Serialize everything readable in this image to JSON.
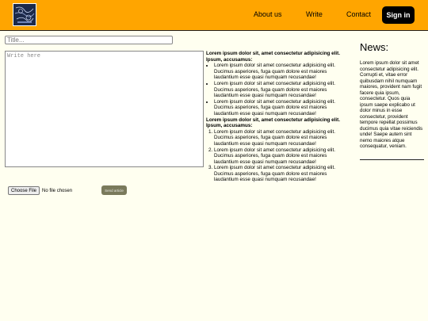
{
  "header": {
    "nav": [
      "About us",
      "Write",
      "Contact"
    ],
    "signin_label": "Sign in"
  },
  "editor": {
    "title_placeholder": "Title...",
    "body_placeholder": "Write here"
  },
  "preview": {
    "heading_1": "Lorem ipsum dolor sit, amet consectetur adipisicing elit. Ipsum, accusamus:",
    "bullets": [
      "Lorem ipsum dolor sit amet consectetur adipisicing elit. Ducimus asperiores, fuga quam dolore est maiores laudantium esse quasi numquam recusandae!",
      "Lorem ipsum dolor sit amet consectetur adipisicing elit. Ducimus asperiores, fuga quam dolore est maiores laudantium esse quasi numquam recusandae!",
      "Lorem ipsum dolor sit amet consectetur adipisicing elit. Ducimus asperiores, fuga quam dolore est maiores laudantium esse quasi numquam recusandae!"
    ],
    "heading_2": "Lorem ipsum dolor sit, amet consectetur adipisicing elit. Ipsum, accusamus:",
    "numbered": [
      "Lorem ipsum dolor sit amet consectetur adipisicing elit. Ducimus asperiores, fuga quam dolore est maiores laudantium esse quasi numquam recusandae!",
      "Lorem ipsum dolor sit amet consectetur adipisicing elit. Ducimus asperiores, fuga quam dolore est maiores laudantium esse quasi numquam recusandae!",
      "Lorem ipsum dolor sit amet consectetur adipisicing elit. Ducimus asperiores, fuga quam dolore est maiores laudantium esse quasi numquam recusandae!"
    ]
  },
  "upload": {
    "choose_label": "Choose File",
    "status": "No file chosen",
    "send_label": "Send article"
  },
  "news": {
    "heading": "News:",
    "text": "Lorem ipsum dolor sit amet consectetur adipisicing elit. Corrupti et, vitae error quibusdam nihil numquam maiores, provident nam fugit facere quia ipsum, consectetur. Quos quia ipsum saepe explicabo ut dolor minus in esse consectetur, provident tempore repellat possimus ducimus quia vitae reiciendis unde! Saepe autem sint nemo maiores atque consequatur, veniam."
  },
  "colors": {
    "header_bg": "#ffa500",
    "page_bg": "#fffff0",
    "signin_bg": "#000000",
    "send_bg": "#7a7a5c"
  },
  "icons": {
    "logo": "logo-icon"
  }
}
